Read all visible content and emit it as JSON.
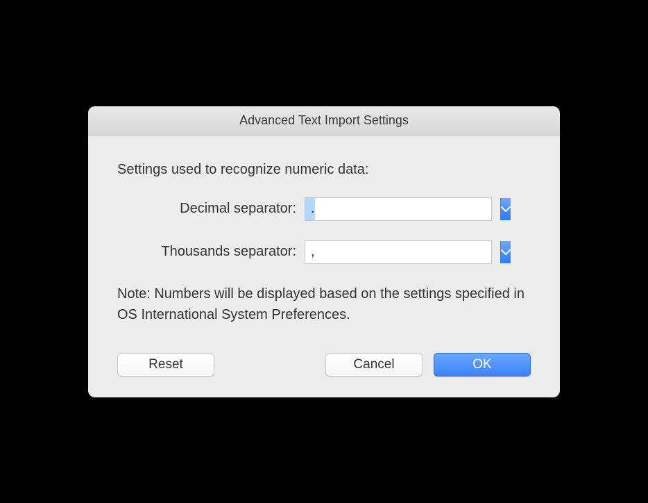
{
  "dialog": {
    "title": "Advanced Text Import Settings",
    "heading": "Settings used to recognize numeric data:",
    "fields": {
      "decimal": {
        "label": "Decimal separator:",
        "value": "."
      },
      "thousands": {
        "label": "Thousands separator:",
        "value": ","
      }
    },
    "note": "Note: Numbers will be displayed based on the settings specified in OS International System Preferences.",
    "buttons": {
      "reset": "Reset",
      "cancel": "Cancel",
      "ok": "OK"
    }
  }
}
